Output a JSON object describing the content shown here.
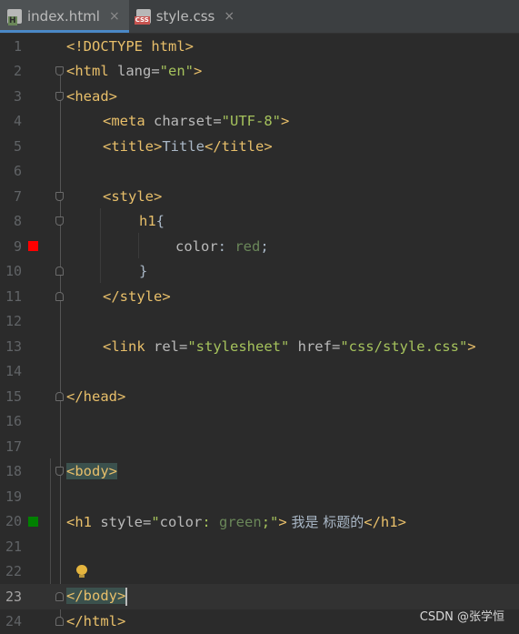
{
  "tabs": [
    {
      "label": "index.html",
      "icon": "html-file-icon",
      "active": true
    },
    {
      "label": "style.css",
      "icon": "css-file-icon",
      "active": false
    }
  ],
  "close_glyph": "×",
  "line_numbers": [
    "1",
    "2",
    "3",
    "4",
    "5",
    "6",
    "7",
    "8",
    "9",
    "10",
    "11",
    "12",
    "13",
    "14",
    "15",
    "16",
    "17",
    "18",
    "19",
    "20",
    "21",
    "22",
    "23",
    "24"
  ],
  "code": {
    "l1": "<!DOCTYPE html>",
    "l2": {
      "open": "<html ",
      "attr": "lang=",
      "val": "\"en\"",
      "close": ">"
    },
    "l3": "<head>",
    "l4": {
      "open": "<meta ",
      "attr": "charset=",
      "val": "\"UTF-8\"",
      "close": ">"
    },
    "l5": {
      "open": "<title>",
      "text": "Title",
      "close": "</title>"
    },
    "l7": "<style>",
    "l8": {
      "selector": "h1",
      "brace": "{"
    },
    "l9": {
      "prop": "color",
      "colon": ": ",
      "value": "red",
      "semi": ";"
    },
    "l10": "}",
    "l11": "</style>",
    "l13": {
      "open": "<link ",
      "attr1": "rel=",
      "val1": "\"stylesheet\"",
      "attr2": " href=",
      "val2": "\"css/style.css\"",
      "close": ">"
    },
    "l15": "</head>",
    "l18": "<body>",
    "l20": {
      "open": "<h1 ",
      "attr": "style=",
      "q1": "\"",
      "prop": "color",
      "colon": ": ",
      "value": "green",
      "semi": ";",
      "q2": "\"",
      "close": ">",
      "text": " 我是 标题的",
      "end": "</h1>"
    },
    "l23": "</body>",
    "l24": "</html>"
  },
  "gutter_colors": {
    "red_swatch": "#ff0000",
    "green_swatch": "#008000"
  },
  "current_line": "23",
  "watermark": "CSDN @张学恒"
}
